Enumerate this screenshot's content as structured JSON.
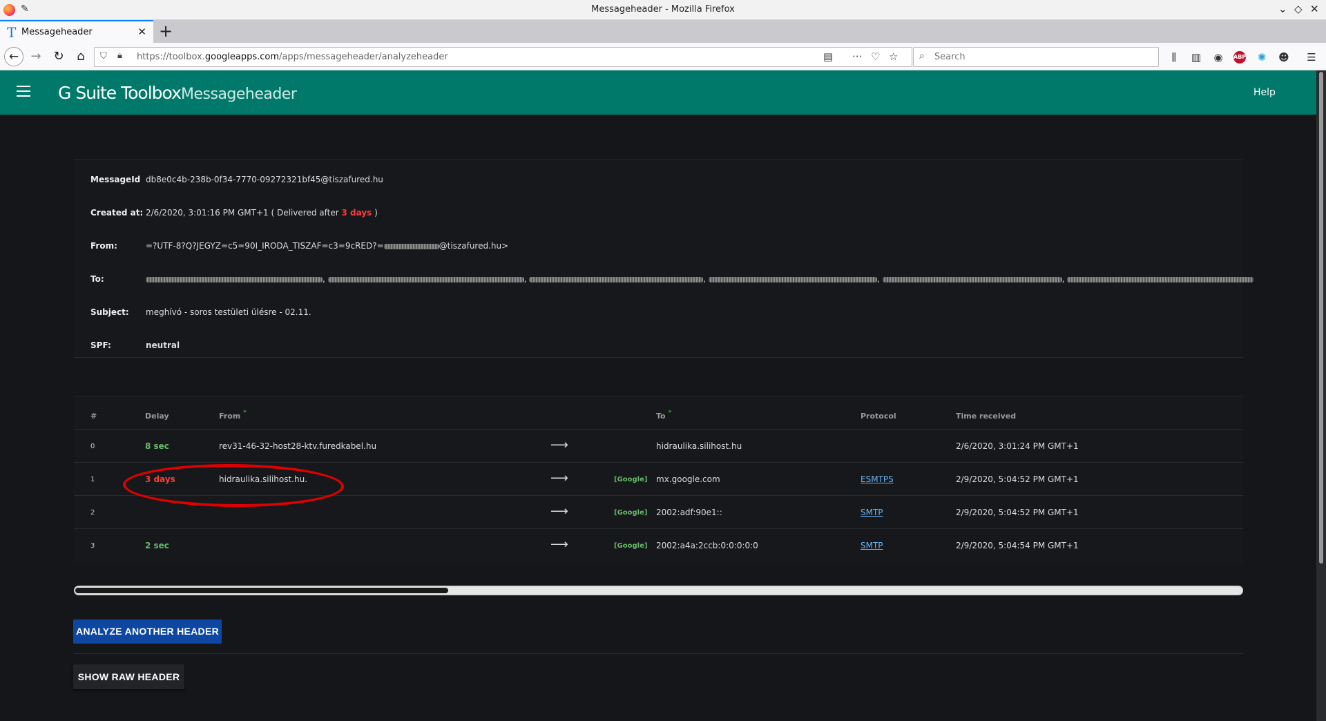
{
  "window": {
    "title": "Messageheader - Mozilla Firefox"
  },
  "tab": {
    "title": "Messageheader",
    "favicon_letter": "T"
  },
  "urlbar": {
    "url_prefix": "https://toolbox.",
    "url_domain": "googleapps.com",
    "url_path": "/apps/messageheader/analyzeheader"
  },
  "search": {
    "placeholder": "Search"
  },
  "app": {
    "brand": "G Suite Toolbox",
    "name": "Messageheader",
    "help": "Help"
  },
  "summary": {
    "message_id_label": "MessageId",
    "message_id": "db8e0c4b-238b-0f34-7770-09272321bf45@tiszafured.hu",
    "created_label": "Created at:",
    "created_value": "2/6/2020, 3:01:16 PM GMT+1",
    "delivered_prefix": "( Delivered after",
    "delivered_delay": "3 days",
    "delivered_suffix": ")",
    "from_label": "From:",
    "from_prefix": "=?UTF-8?Q?JEGYZ=c5=90I_IRODA_TISZAF=c3=9cRED?=",
    "from_suffix": "@tiszafured.hu>",
    "to_label": "To:",
    "subject_label": "Subject:",
    "subject": "meghívó - soros testületi ülésre - 02.11.",
    "spf_label": "SPF:",
    "spf": "neutral"
  },
  "hops": {
    "headers": {
      "index": "#",
      "delay": "Delay",
      "from": "From",
      "to": "To",
      "protocol": "Protocol",
      "time": "Time received"
    },
    "rows": [
      {
        "index": "0",
        "delay": "8 sec",
        "from": "rev31-46-32-host28-ktv.furedkabel.hu",
        "arrow": "⟶",
        "badge": "",
        "to": "hidraulika.silihost.hu",
        "protocol": "",
        "time": "2/6/2020, 3:01:24 PM GMT+1"
      },
      {
        "index": "1",
        "delay": "3 days",
        "from": "hidraulika.silihost.hu.",
        "arrow": "⟶",
        "badge": "[Google]",
        "to": "mx.google.com",
        "protocol": "ESMTPS",
        "time": "2/9/2020, 5:04:52 PM GMT+1"
      },
      {
        "index": "2",
        "delay": "",
        "from": "",
        "arrow": "⟶",
        "badge": "[Google]",
        "to": "2002:adf:90e1::",
        "protocol": "SMTP",
        "time": "2/9/2020, 5:04:52 PM GMT+1"
      },
      {
        "index": "3",
        "delay": "2 sec",
        "from": "",
        "arrow": "⟶",
        "badge": "[Google]",
        "to": "2002:a4a:2ccb:0:0:0:0:0",
        "protocol": "SMTP",
        "time": "2/9/2020, 5:04:54 PM GMT+1"
      }
    ]
  },
  "buttons": {
    "analyze": "ANALYZE ANOTHER HEADER",
    "raw": "SHOW RAW HEADER"
  },
  "colors": {
    "header_teal": "#00796b",
    "delay_green": "#66bb6a",
    "delay_red": "#ff3b3b",
    "spf_orange": "#ffb74d",
    "primary_button": "#0d47a1"
  }
}
